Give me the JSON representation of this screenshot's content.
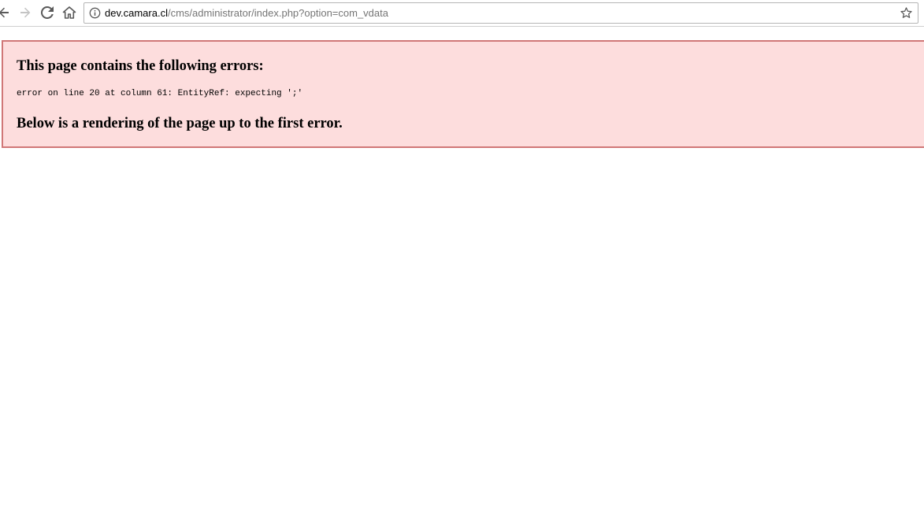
{
  "browser": {
    "url_host": "dev.camara.cl",
    "url_path": "/cms/administrator/index.php?option=com_vdata"
  },
  "icons": {
    "back": "arrow-left-icon",
    "forward": "arrow-right-icon",
    "reload": "reload-icon",
    "home": "home-icon",
    "info": "info-icon",
    "bookmark": "star-icon"
  },
  "colors": {
    "error_background": "#fddddd",
    "error_border": "#d07777"
  },
  "error": {
    "title": "This page contains the following errors:",
    "detail": "error on line 20 at column 61: EntityRef: expecting ';'",
    "footer": "Below is a rendering of the page up to the first error."
  }
}
